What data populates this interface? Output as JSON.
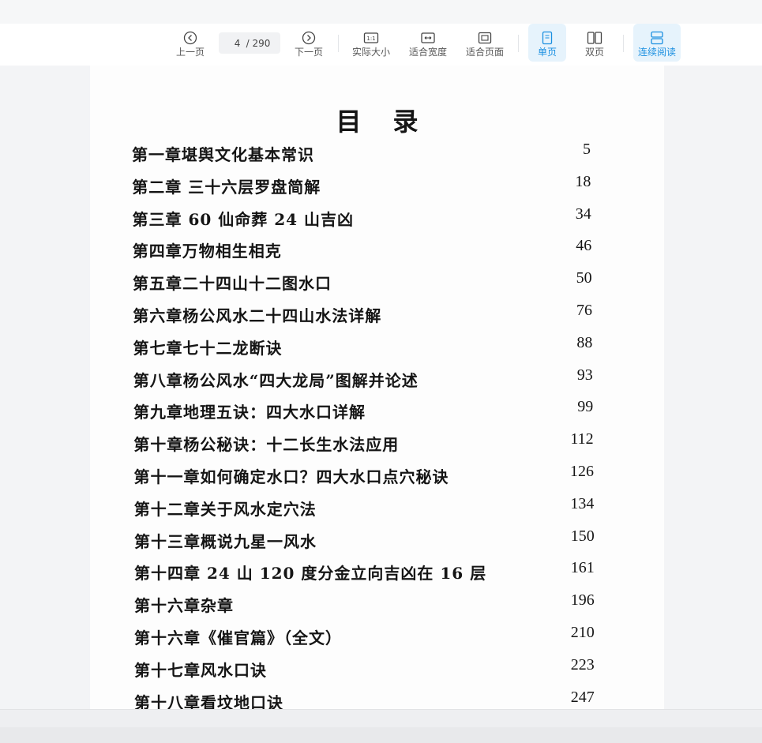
{
  "toolbar": {
    "prev_label": "上一页",
    "next_label": "下一页",
    "current_page": "4",
    "total_pages": "/ 290",
    "actual_size_label": "实际大小",
    "actual_size_glyph": "1:1",
    "fit_width_label": "适合宽度",
    "fit_page_label": "适合页面",
    "single_page_label": "单页",
    "double_page_label": "双页",
    "continuous_label": "连续阅读",
    "accent_color": "#1a8fe0"
  },
  "document": {
    "title": "目录",
    "toc": [
      {
        "title": "第一章堪舆文化基本常识",
        "page": "5"
      },
      {
        "title": "第二章  三十六层罗盘简解",
        "page": "18"
      },
      {
        "title": "第三章 60 仙命葬 24 山吉凶",
        "page": "34"
      },
      {
        "title": "第四章万物相生相克",
        "page": "46"
      },
      {
        "title": "第五章二十四山十二图水口",
        "page": "50"
      },
      {
        "title": "第六章杨公风水二十四山水法详解",
        "page": "76"
      },
      {
        "title": "第七章七十二龙断诀",
        "page": "88"
      },
      {
        "title": "第八章杨公风水“四大龙局”图解并论述",
        "page": "93"
      },
      {
        "title": "第九章地理五诀：四大水口详解",
        "page": "99"
      },
      {
        "title": "第十章杨公秘诀：十二长生水法应用",
        "page": "112"
      },
      {
        "title": "第十一章如何确定水口？四大水口点穴秘诀",
        "page": "126"
      },
      {
        "title": "第十二章关于风水定穴法",
        "page": "134"
      },
      {
        "title": "第十三章概说九星一风水",
        "page": "150"
      },
      {
        "title": "第十四章  24 山 120 度分金立向吉凶在 16 层",
        "page": "161"
      },
      {
        "title": "第十六章杂章",
        "page": "196"
      },
      {
        "title": "第十六章《催官篇》（全文）",
        "page": "210"
      },
      {
        "title": "第十七章风水口诀",
        "page": "223"
      },
      {
        "title": "第十八章看坟地口诀",
        "page": "247"
      }
    ]
  }
}
